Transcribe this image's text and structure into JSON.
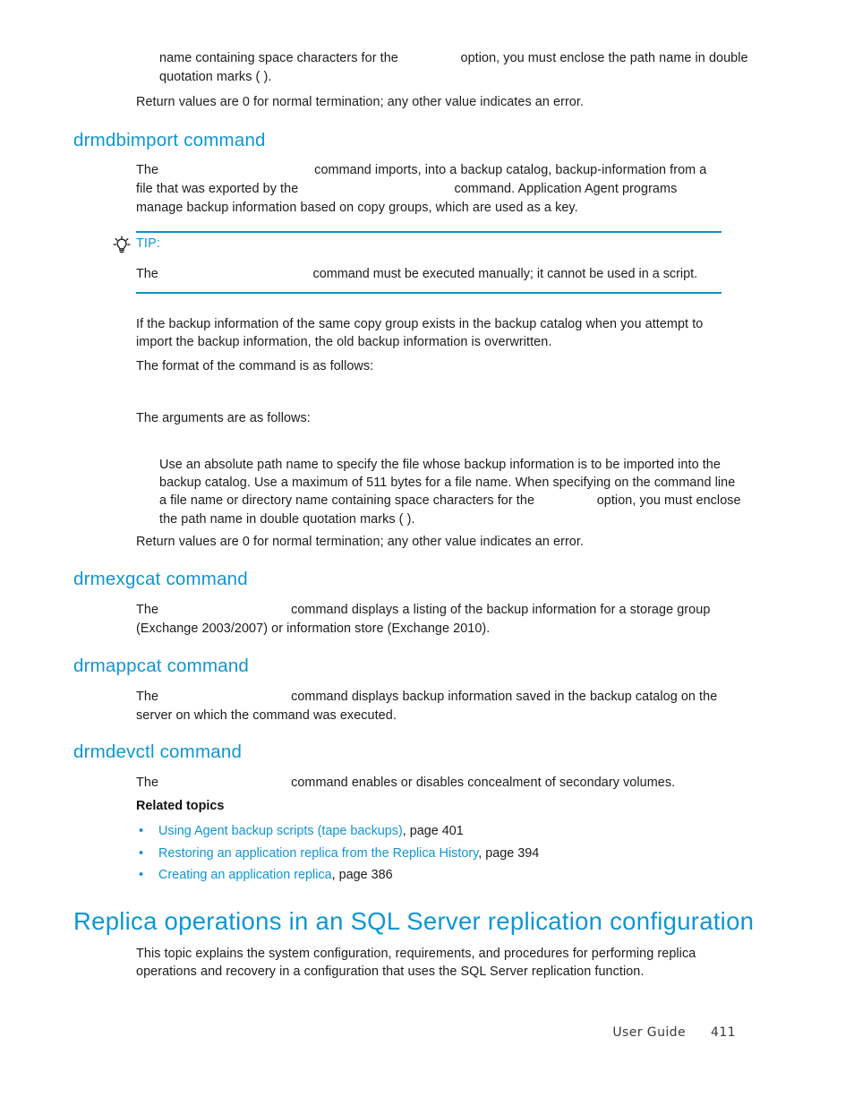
{
  "page": {
    "accent_color": "#0f96d2",
    "rule_color": "#0f8fc9",
    "text_color": "#1c1c1c",
    "background": "#ffffff"
  },
  "top_paragraph": {
    "line1": "name containing space characters for the",
    "slot1": "        ",
    "line1b": "option, you must enclose the path name in double",
    "line2": "quotation marks (  )."
  },
  "return_values_1": "Return values are 0 for normal termination; any other value indicates an error.",
  "drmdbimport": {
    "heading": "drmdbimport command",
    "para_pre": "The",
    "para_slot1": "                    ",
    "para_mid": "command imports, into a backup catalog, backup-information from a file that was exported by the",
    "para_slot2": "                    ",
    "para_post": "command. Application Agent programs manage backup information based on copy groups, which are used as a key."
  },
  "tip": {
    "icon": "lightbulb-icon",
    "label": "TIP:",
    "body_pre": "The",
    "body_slot": "                    ",
    "body_post": "command must be executed manually; it cannot be used in a script."
  },
  "overwrite_note": "If the backup information of the same copy group exists in the backup catalog when you attempt to import the backup information, the old backup information is overwritten.",
  "format_intro": "The format of the command is as follows:",
  "format_code": "                                                           ",
  "arguments_intro": "The arguments are as follows:",
  "argument_body": {
    "part1": "Use an absolute path name to specify the file whose backup information is to be imported into the backup catalog. Use a maximum of 511 bytes for a file name. When specifying on the command line a file name or directory name containing space characters for the",
    "slot": "        ",
    "part2": "option, you must enclose the path name in double quotation marks (  )."
  },
  "return_values_2": "Return values are 0 for normal termination; any other value indicates an error.",
  "drmexgcat": {
    "heading": "drmexgcat command",
    "para_pre": "The",
    "para_slot": "                 ",
    "para_post": "command displays a listing of the backup information for a storage group (Exchange 2003/2007) or information store (Exchange 2010)."
  },
  "drmappcat": {
    "heading": "drmappcat command",
    "para_pre": "The",
    "para_slot": "                 ",
    "para_post": "command displays backup information saved in the backup catalog on the server on which the command was executed."
  },
  "drmdevctl": {
    "heading": "drmdevctl command",
    "para_pre": "The",
    "para_slot": "                 ",
    "para_post": "command enables or disables concealment of secondary volumes."
  },
  "related_topics": {
    "label": "Related topics",
    "items": [
      {
        "bullet": "•",
        "link": "Using Agent backup scripts (tape backups)",
        "page_ref": ", page 401"
      },
      {
        "bullet": "•",
        "link": "Restoring an application replica from the Replica History",
        "page_ref": ", page 394"
      },
      {
        "bullet": "•",
        "link": "Creating an application replica",
        "page_ref": ", page 386"
      }
    ]
  },
  "replica_section": {
    "heading": "Replica operations in an SQL Server replication configuration",
    "paragraph": "This topic explains the system configuration, requirements, and procedures for performing replica operations and recovery in a configuration that uses the SQL Server replication function."
  },
  "footer": {
    "guide_label": "User Guide",
    "page_number": "411"
  }
}
